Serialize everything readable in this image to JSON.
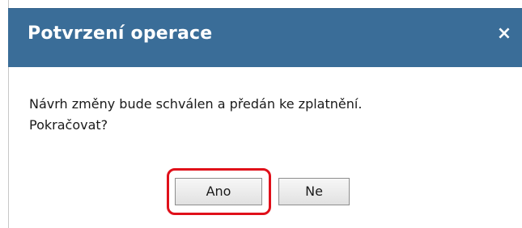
{
  "dialog": {
    "title": "Potvrzení operace",
    "close_symbol": "×",
    "message_line1": "Návrh změny bude schválen a předán ke zplatnění.",
    "message_line2": "Pokračovat?",
    "buttons": {
      "yes_label": "Ano",
      "no_label": "Ne"
    }
  },
  "colors": {
    "titlebar": "#3a6d98",
    "highlight": "#e0101a"
  }
}
